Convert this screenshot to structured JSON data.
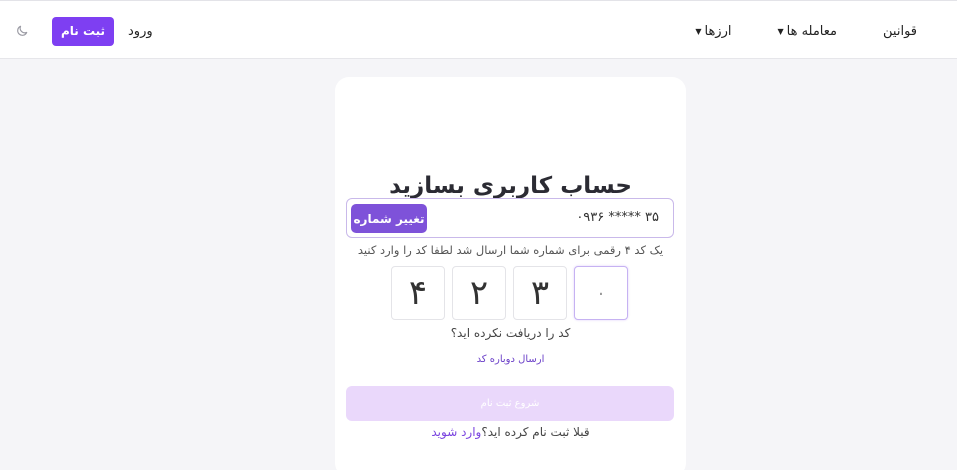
{
  "nav": {
    "signup_label": "ثبت نام",
    "login_label": "ورود",
    "items": [
      {
        "label": "ارزها",
        "has_caret": true
      },
      {
        "label": "معامله ها",
        "has_caret": true
      },
      {
        "label": "قوانین",
        "has_caret": false
      }
    ],
    "theme_icon": "moon-icon"
  },
  "card": {
    "title": "حساب کاربری بسازید",
    "phone_number": "۰۹۳۶ ***** ۳۵",
    "change_number_label": "تغییر شماره",
    "instruction": "یک کد ۴ رقمی برای شماره شما ارسال شد لطفا کد را وارد کنید",
    "otp_digits": [
      "۴",
      "۲",
      "۳",
      "۰"
    ],
    "not_received": "کد را دریافت نکرده اید؟",
    "resend_label": "ارسال دوباره کد",
    "start_label": "شروع ثبت نام",
    "already_text": "قبلا ثبت نام کرده اید؟",
    "login_inline": "وارد شوید"
  },
  "colors": {
    "accent": "#7e3ff2",
    "change_button": "#7e52d9",
    "start_button_disabled": "#ead8fb",
    "link": "#7a44e0",
    "background": "#f5f5f8"
  }
}
